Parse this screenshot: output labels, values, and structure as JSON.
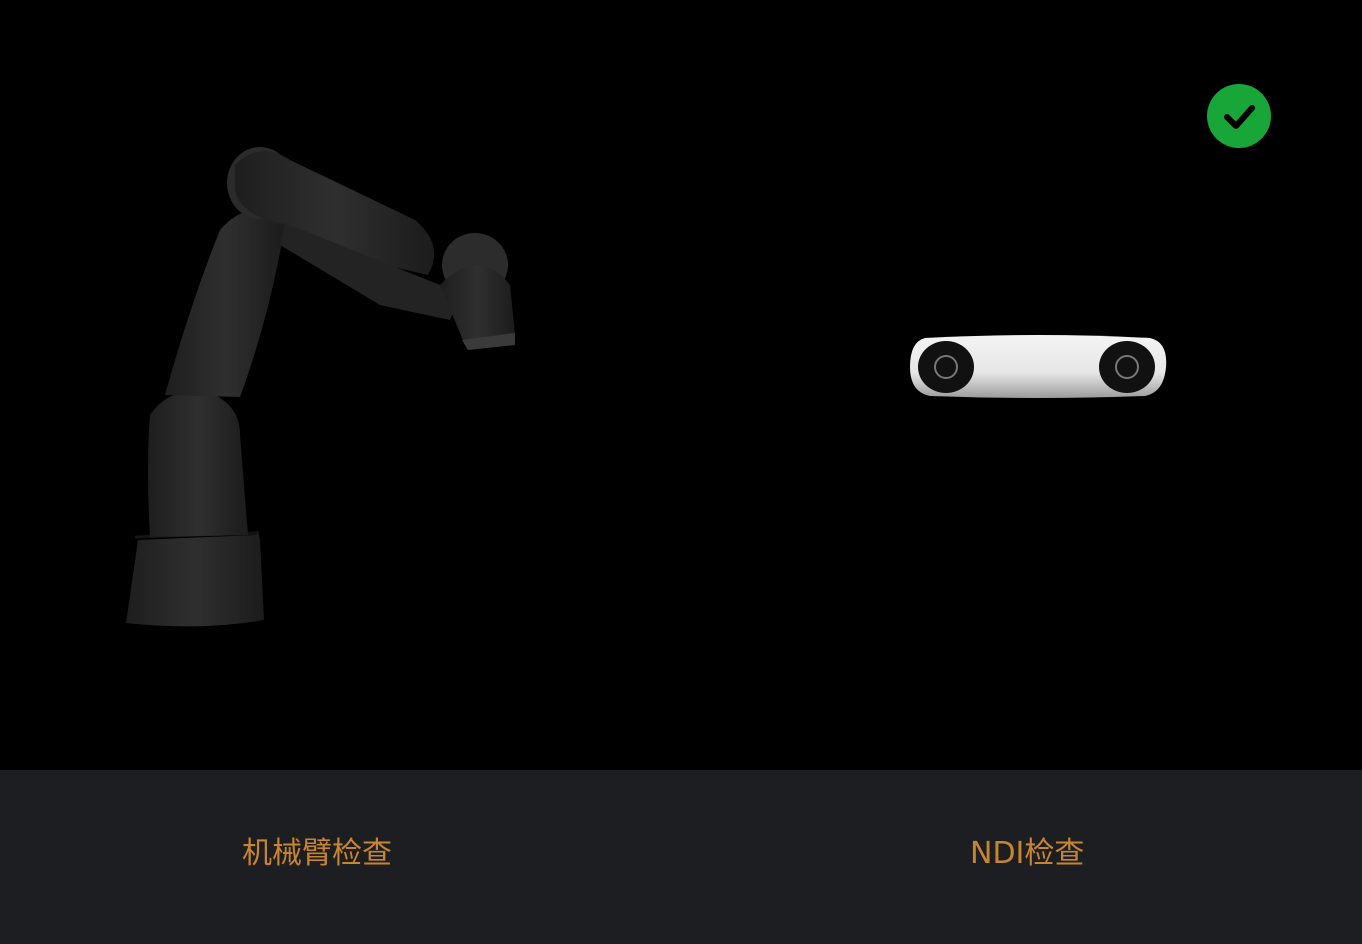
{
  "labels": {
    "arm_check": "机械臂检查",
    "ndi_check": "NDI检查"
  },
  "status": {
    "ndi_check_passed": true,
    "check_color": "#17a637"
  },
  "icons": {
    "robot_arm": "robot-arm-icon",
    "ndi_tracker": "ndi-tracker-icon",
    "status_ok": "checkmark-icon"
  },
  "colors": {
    "label": "#c8852f",
    "bottom_bar": "#1d1e21",
    "background": "#000000"
  }
}
